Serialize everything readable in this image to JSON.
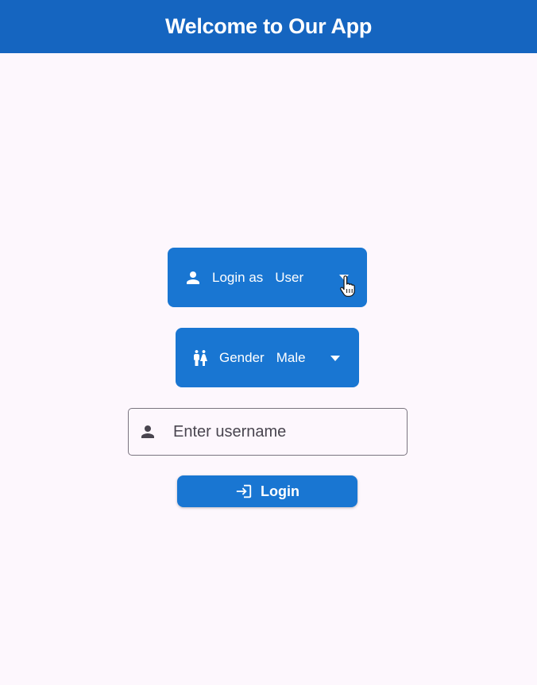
{
  "app_bar": {
    "title": "Welcome to Our App",
    "color": "#1565c0"
  },
  "role_dropdown": {
    "icon": "person-icon",
    "label": "Login as",
    "value": "User",
    "arrow_icon": "arrow-drop-down-icon"
  },
  "gender_dropdown": {
    "icon": "wc-gender-icon",
    "label": "Gender",
    "value": "Male",
    "arrow_icon": "arrow-drop-down-icon"
  },
  "username_field": {
    "icon": "person-icon",
    "placeholder": "Enter username",
    "value": ""
  },
  "login_button": {
    "icon": "login-icon",
    "label": "Login"
  },
  "colors": {
    "accent": "#1976d2",
    "background": "#fdf7fd"
  }
}
